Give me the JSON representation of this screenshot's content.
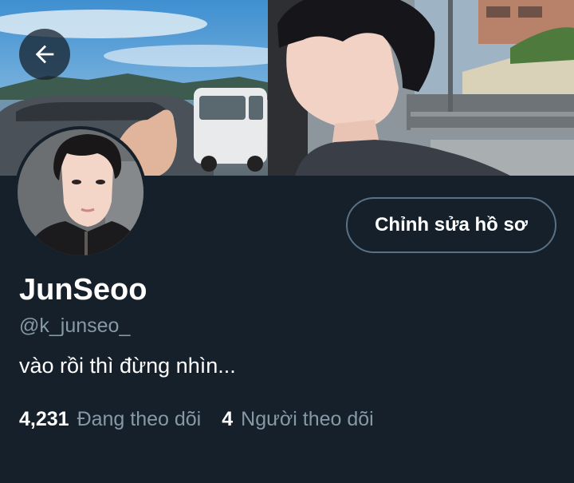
{
  "profile": {
    "display_name": "JunSeoo",
    "handle": "@k_junseo_",
    "bio": "vào rồi thì đừng nhìn...",
    "edit_button_label": "Chỉnh sửa hồ sơ"
  },
  "stats": {
    "following_count": "4,231",
    "following_label": "Đang theo dõi",
    "followers_count": "4",
    "followers_label": "Người theo dõi"
  },
  "icons": {
    "back": "arrow-left-icon"
  },
  "colors": {
    "background": "#15202b",
    "secondary_text": "#8899a6",
    "border": "#5b7083"
  }
}
